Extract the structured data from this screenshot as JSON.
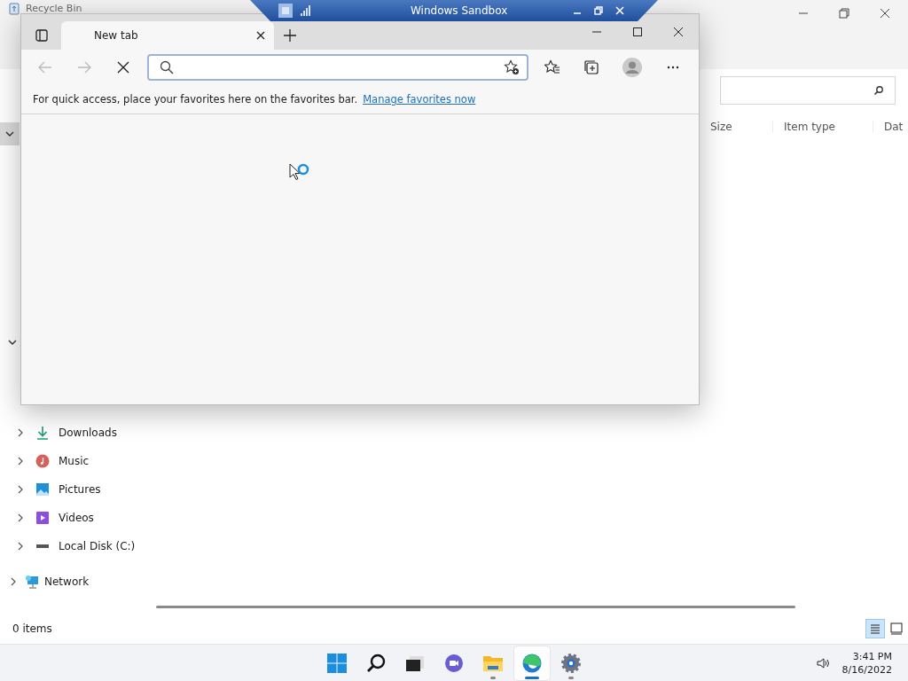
{
  "sandbox_bar": {
    "title": "Windows Sandbox"
  },
  "explorer": {
    "title": "Recycle Bin",
    "columns": [
      "Size",
      "Item type",
      "Dat"
    ],
    "nav_items": [
      {
        "label": "Downloads",
        "kind": "downloads"
      },
      {
        "label": "Music",
        "kind": "music"
      },
      {
        "label": "Pictures",
        "kind": "pictures"
      },
      {
        "label": "Videos",
        "kind": "videos"
      },
      {
        "label": "Local Disk (C:)",
        "kind": "disk"
      }
    ],
    "network": "Network",
    "status": "0 items",
    "views": [
      {
        "kind": "details",
        "selected": true
      },
      {
        "kind": "tiles",
        "selected": false
      }
    ]
  },
  "browser": {
    "tab": {
      "title": "New tab"
    },
    "favorites_bar": {
      "message": "For quick access, place your favorites here on the favorites bar.",
      "link": "Manage favorites now"
    }
  },
  "taskbar": {
    "apps": [
      {
        "kind": "start",
        "running": false,
        "selected": false
      },
      {
        "kind": "search",
        "running": false,
        "selected": false
      },
      {
        "kind": "taskview",
        "running": false,
        "selected": false
      },
      {
        "kind": "chat",
        "running": false,
        "selected": false
      },
      {
        "kind": "explorer",
        "running": true,
        "selected": false
      },
      {
        "kind": "edge",
        "running": true,
        "selected": true
      },
      {
        "kind": "settings",
        "running": true,
        "selected": false
      }
    ],
    "time": "3:41 PM",
    "date": "8/16/2022"
  }
}
